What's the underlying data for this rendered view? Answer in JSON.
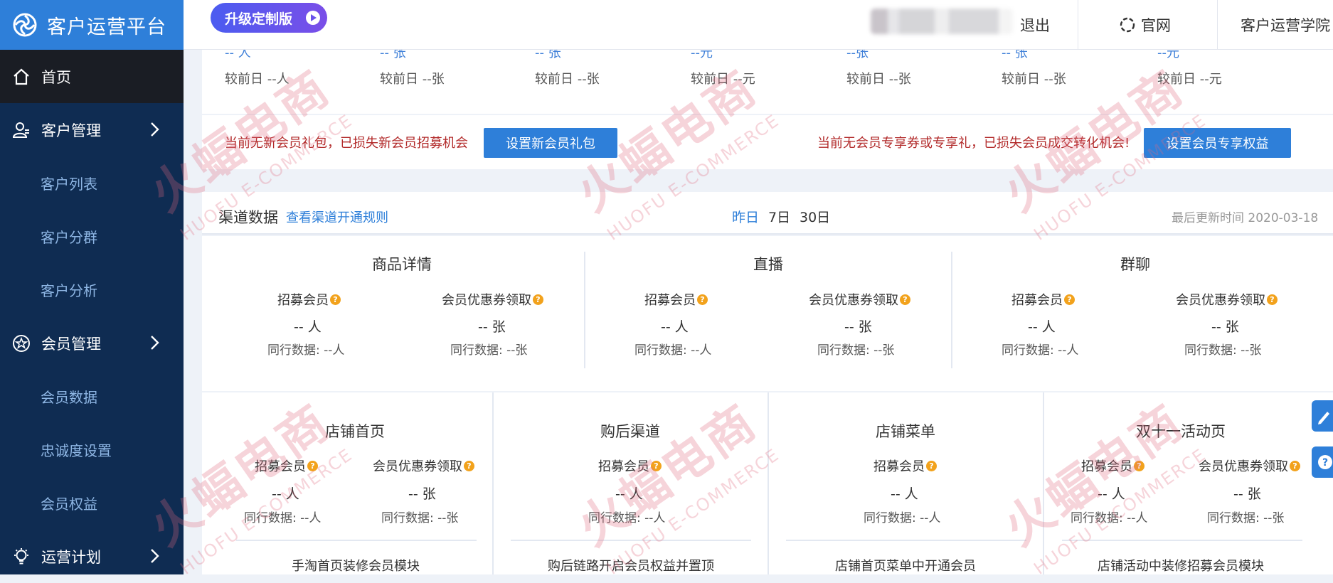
{
  "app": {
    "title": "客户运营平台"
  },
  "topbar": {
    "upgrade_label": "升级定制版",
    "logout": "退出",
    "official_site": "官网",
    "academy": "客户运营学院"
  },
  "sidebar": {
    "home": "首页",
    "customer_mgmt": "客户管理",
    "customer_list": "客户列表",
    "customer_group": "客户分群",
    "customer_analysis": "客户分析",
    "member_mgmt": "会员管理",
    "member_data": "会员数据",
    "loyalty_settings": "忠诚度设置",
    "member_benefits": "会员权益",
    "ops_plan": "运营计划"
  },
  "stats": [
    {
      "value": "-- 人",
      "prev": "较前日 --人"
    },
    {
      "value": "-- 张",
      "prev": "较前日 --张"
    },
    {
      "value": "-- 张",
      "prev": "较前日 --张"
    },
    {
      "value": "--元",
      "prev": "较前日 --元"
    },
    {
      "value": "--张",
      "prev": "较前日 --张"
    },
    {
      "value": "-- 张",
      "prev": "较前日 --张"
    },
    {
      "value": "--元",
      "prev": "较前日 --元"
    }
  ],
  "alerts": {
    "gift_warning": "当前无新会员礼包，已损失新会员招募机会",
    "gift_button": "设置新会员礼包",
    "benefit_warning": "当前无会员专享券或专享礼，已损失会员成交转化机会!",
    "benefit_button": "设置会员专享权益"
  },
  "channel": {
    "title": "渠道数据",
    "rules_link": "查看渠道开通规则",
    "range_yesterday": "昨日",
    "range_7": "7日",
    "range_30": "30日",
    "updated": "最后更新时间 2020-03-18"
  },
  "metrics": {
    "recruit": "招募会员",
    "coupon": "会员优惠券领取",
    "people_value": "-- 人",
    "coupon_value": "-- 张",
    "peer_people": "同行数据:  --人",
    "peer_coupon": "同行数据:  --张"
  },
  "channels_row1": [
    "商品详情",
    "直播",
    "群聊"
  ],
  "channels_row2": [
    {
      "title": "店铺首页",
      "tip": "手淘首页装修会员模块"
    },
    {
      "title": "购后渠道",
      "tip": "购后链路开启会员权益并置顶"
    },
    {
      "title": "店铺菜单",
      "tip": "店铺首页菜单中开通会员"
    },
    {
      "title": "双十一活动页",
      "tip": "店铺活动中装修招募会员模块"
    }
  ],
  "watermark": {
    "text": "火蝠电商",
    "sub": "HUOFU E-COMMERCE"
  },
  "colors": {
    "sidebar": "#0f2c52",
    "accent": "#2e7fd9",
    "warning": "#b22a2a",
    "question": "#f2a21c"
  }
}
